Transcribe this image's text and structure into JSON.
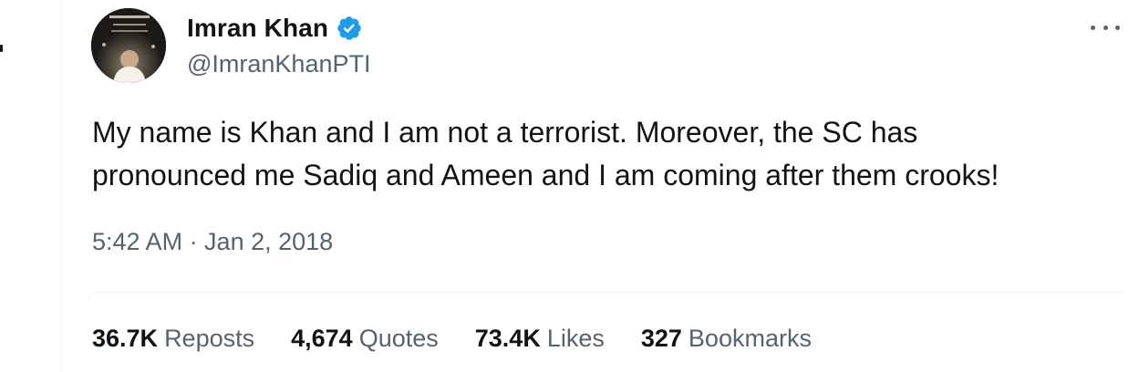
{
  "author": {
    "display_name": "Imran Khan",
    "handle": "@ImranKhanPTI",
    "verified": true,
    "verified_color": "#1d9bf0"
  },
  "tweet": {
    "text_lines": [
      "My name is Khan and I am not a terrorist. Moreover, the SC has",
      "pronounced me Sadiq and Ameen and I am coming after them crooks!"
    ],
    "timestamp": "5:42 AM · Jan 2, 2018"
  },
  "stats": [
    {
      "count": "36.7K",
      "label": "Reposts"
    },
    {
      "count": "4,674",
      "label": "Quotes"
    },
    {
      "count": "73.4K",
      "label": "Likes"
    },
    {
      "count": "327",
      "label": "Bookmarks"
    }
  ],
  "icons": {
    "more": "more-horizontal-icon",
    "verified": "verified-badge-icon"
  },
  "colors": {
    "text_primary": "#0f1419",
    "text_secondary": "#536471",
    "divider": "#eff3f4"
  }
}
